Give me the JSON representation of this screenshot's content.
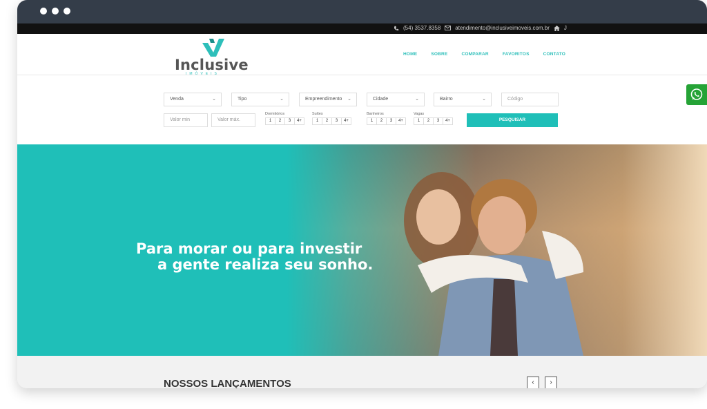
{
  "contact": {
    "phone": "(54) 3537.8358",
    "email": "atendimento@inclusiveimoveis.com.br",
    "extra": "J"
  },
  "logo": {
    "name": "Inclusive",
    "sub": "IMÓVEIS"
  },
  "nav": [
    "HOME",
    "SOBRE",
    "COMPARAR",
    "FAVORITOS",
    "CONTATO"
  ],
  "filters": {
    "negocio": "Venda",
    "tipo": "Tipo",
    "empreendimento": "Empreendimento",
    "cidade": "Cidade",
    "bairro": "Bairro",
    "codigo_placeholder": "Código",
    "valor_min_placeholder": "Valor min",
    "valor_max_placeholder": "Valor máx.",
    "dormitorios_label": "Dormitórios",
    "suites_label": "Suítes",
    "banheiros_label": "Banheiros",
    "vagas_label": "Vagas",
    "options": [
      "1",
      "2",
      "3",
      "4+"
    ],
    "search_button": "PESQUISAR"
  },
  "hero": {
    "line1": "Para morar ou para investir",
    "line2": "a gente realiza seu sonho."
  },
  "lancamentos": {
    "title": "NOSSOS LANÇAMENTOS",
    "prev": "‹",
    "next": "›"
  },
  "colors": {
    "accent": "#1fbfb8",
    "whatsapp": "#25a336"
  }
}
